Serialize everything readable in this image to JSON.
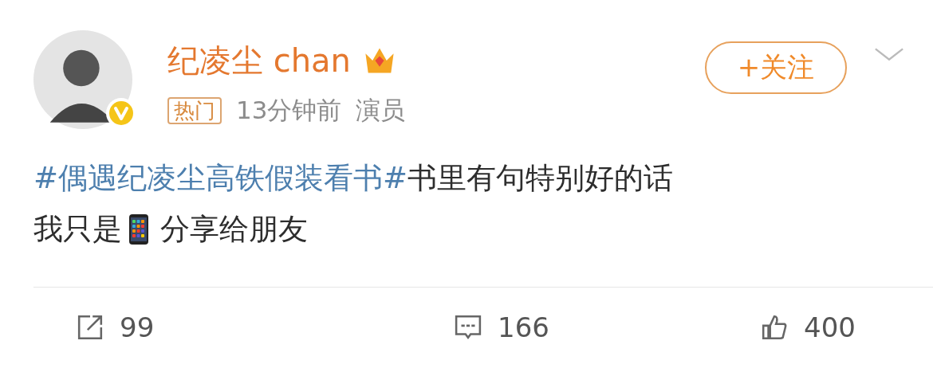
{
  "author": {
    "name": "纪凌尘 chan",
    "verified": true,
    "tag": "热门",
    "time": "13分钟前",
    "role": "演员"
  },
  "follow_button": {
    "label": "+关注"
  },
  "post": {
    "hashtag": "#偶遇纪凌尘高铁假装看书#",
    "text_1": "书里有句特别好的话",
    "text_2": "我只是",
    "text_3": "分享给朋友"
  },
  "actions": [
    {
      "kind": "repost",
      "count": "99"
    },
    {
      "kind": "comment",
      "count": "166"
    },
    {
      "kind": "like",
      "count": "400"
    }
  ]
}
